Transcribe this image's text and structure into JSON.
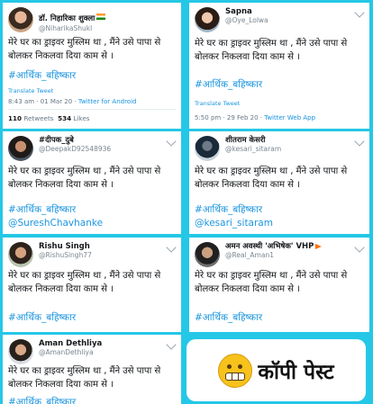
{
  "tweet_text": "मेरे घर का ड्राइवर मुस्लिम था , मैंने उसे पापा से बोलकर निकलवा दिया काम से ।",
  "hashtag": "#आर्थिक_बहिष्कार",
  "translate_label": "Translate Tweet",
  "tweets": [
    {
      "name": "डॉ. निहारिका शुक्ला",
      "handle": "@NiharikaShukl",
      "meta_time": "8:43 am · 01 Mar 20 · ",
      "meta_source": "Twitter for Android",
      "retweets": "110",
      "retweets_label": "Retweets",
      "likes": "534",
      "likes_label": "Likes"
    },
    {
      "name": "Sapna",
      "handle": "@Oye_Lolwa",
      "meta_time": "5:50 pm · 29 Feb 20 · ",
      "meta_source": "Twitter Web App"
    },
    {
      "name": "#दीपक_दुबे",
      "handle": "@DeepakD92548936",
      "mention": "@SureshChavhanke"
    },
    {
      "name": "शीतराम केसरी",
      "handle": "@kesari_sitaram",
      "mention": "@kesari_sitaram"
    },
    {
      "name": "Rishu Singh",
      "handle": "@RishuSingh77"
    },
    {
      "name": "अमन अवस्थी 'अभिषेक' VHP",
      "handle": "@Real_Aman1"
    },
    {
      "name": "Aman Dethliya",
      "handle": "@AmanDethliya"
    }
  ],
  "copy_paste_label": "कॉपी पेस्ट",
  "colors": {
    "background": "#25c7e6",
    "link": "#1b95e0",
    "text": "#14171a",
    "muted": "#657786"
  }
}
